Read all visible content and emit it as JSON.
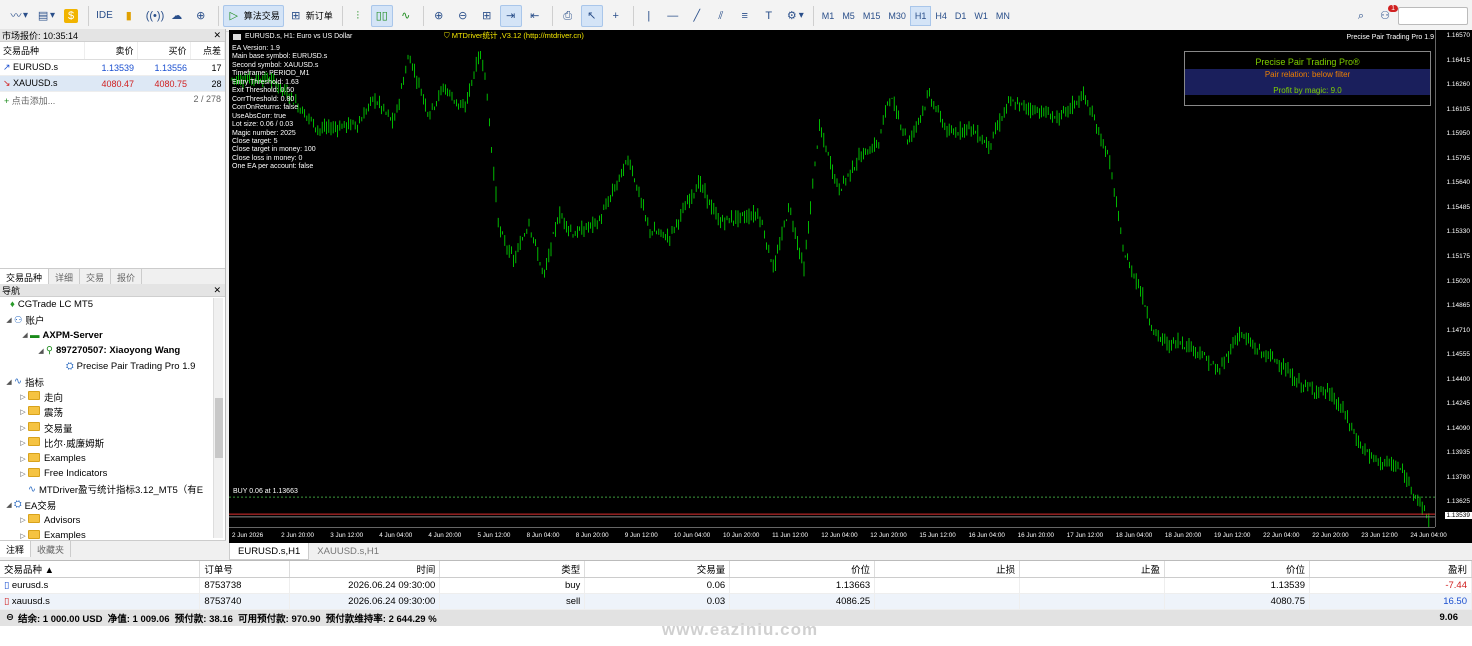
{
  "toolbar": {
    "ide_label": "IDE",
    "algo_label": "算法交易",
    "new_order_label": "新订单",
    "timeframes": [
      "M1",
      "M5",
      "M15",
      "M30",
      "H1",
      "H4",
      "D1",
      "W1",
      "MN"
    ],
    "active_timeframe": "H1",
    "notification_count": "1"
  },
  "market_watch": {
    "title": "市场报价: 10:35:14",
    "headers": {
      "symbol": "交易品种",
      "bid": "卖价",
      "ask": "买价",
      "spread": "点差"
    },
    "rows": [
      {
        "symbol": "EURUSD.s",
        "bid": "1.13539",
        "ask": "1.13556",
        "spread": "17",
        "bid_color": "#1a4fd0",
        "ask_color": "#1a4fd0"
      },
      {
        "symbol": "XAUUSD.s",
        "bid": "4080.47",
        "ask": "4080.75",
        "spread": "28",
        "bid_color": "#d02020",
        "ask_color": "#d02020"
      }
    ],
    "add_label": "点击添加...",
    "count": "2 / 278",
    "tabs": [
      "交易品种",
      "详细",
      "交易",
      "报价"
    ]
  },
  "navigator": {
    "title": "导航",
    "root": "CGTrade LC MT5",
    "accounts": "账户",
    "server": "AXPM-Server",
    "account": "897270507: Xiaoyong Wang",
    "ea_attached": "Precise Pair Trading Pro 1.9",
    "indicators": "指标",
    "ind_folders": [
      "走向",
      "震荡",
      "交易量",
      "比尔·威廉姆斯",
      "Examples",
      "Free Indicators"
    ],
    "ind_item": "MTDriver盈亏统计指标3.12_MT5（有E",
    "experts": "EA交易",
    "ea_folders": [
      "Advisors",
      "Examples"
    ],
    "tabs": [
      "注释",
      "收藏夹"
    ]
  },
  "chart": {
    "header": "EURUSD.s, H1: Euro vs US Dollar",
    "mtdriver": "MTDriver统计 ,V3.12 (http://mtdriver.cn)",
    "product": "Precise Pair Trading Pro 1.9",
    "ea_lines": [
      "EA Version: 1.9",
      "Main base symbol: EURUSD.s",
      "Second symbol: XAUUSD.s",
      "Timeframe: PERIOD_M1",
      "Entry Threshold: 1.63",
      "Exit Threshold: 0.50",
      "CorrThreshold: 0.80",
      "CorrOnReturns: false",
      "UseAbsCorr: true",
      "Lot size: 0.06 / 0.03",
      "Magic number: 2025",
      "Close target: 5",
      "Close target in money: 100",
      "Close loss in money: 0",
      "One EA per account: false"
    ],
    "panel": {
      "title": "Precise Pair Trading Pro®",
      "relation": "Pair relation: below filter",
      "profit": "Profit by magic: 9.0"
    },
    "buy_label": "BUY 0.06 at 1.13663",
    "price_labels": [
      "1.16570",
      "1.16415",
      "1.16260",
      "1.16105",
      "1.15950",
      "1.15795",
      "1.15640",
      "1.15485",
      "1.15330",
      "1.15175",
      "1.15020",
      "1.14865",
      "1.14710",
      "1.14555",
      "1.14400",
      "1.14245",
      "1.14090",
      "1.13935",
      "1.13780",
      "1.13625",
      "1.13539"
    ],
    "time_labels": [
      "2 Jun 2026",
      "2 Jun 20:00",
      "3 Jun 12:00",
      "4 Jun 04:00",
      "4 Jun 20:00",
      "5 Jun 12:00",
      "8 Jun 04:00",
      "8 Jun 20:00",
      "9 Jun 12:00",
      "10 Jun 04:00",
      "10 Jun 20:00",
      "11 Jun 12:00",
      "12 Jun 04:00",
      "12 Jun 20:00",
      "15 Jun 12:00",
      "16 Jun 04:00",
      "16 Jun 20:00",
      "17 Jun 12:00",
      "18 Jun 04:00",
      "18 Jun 20:00",
      "19 Jun 12:00",
      "22 Jun 04:00",
      "22 Jun 20:00",
      "23 Jun 12:00",
      "24 Jun 04:00"
    ],
    "tabs": [
      "EURUSD.s,H1",
      "XAUUSD.s,H1"
    ],
    "candle_color": "#00e600"
  },
  "terminal": {
    "headers": [
      "交易品种",
      "订单号",
      "时间",
      "类型",
      "交易量",
      "价位",
      "止损",
      "止盈",
      "价位",
      "盈利"
    ],
    "rows": [
      {
        "symbol": "eurusd.s",
        "ticket": "8753738",
        "time": "2026.06.24 09:30:00",
        "type": "buy",
        "volume": "0.06",
        "price": "1.13663",
        "sl": "",
        "tp": "",
        "current": "1.13539",
        "profit": "-7.44",
        "profit_color": "#d02020"
      },
      {
        "symbol": "xauusd.s",
        "ticket": "8753740",
        "time": "2026.06.24 09:30:00",
        "type": "sell",
        "volume": "0.03",
        "price": "4086.25",
        "sl": "",
        "tp": "",
        "current": "4080.75",
        "profit": "16.50",
        "profit_color": "#1a4fd0"
      }
    ],
    "balance_line": "结余: 1 000.00 USD  净值: 1 009.06  预付款: 38.16  可用预付款: 970.90  预付款维持率: 2 644.29 %",
    "total": "9.06"
  },
  "watermark": "www.eaziniu.com"
}
